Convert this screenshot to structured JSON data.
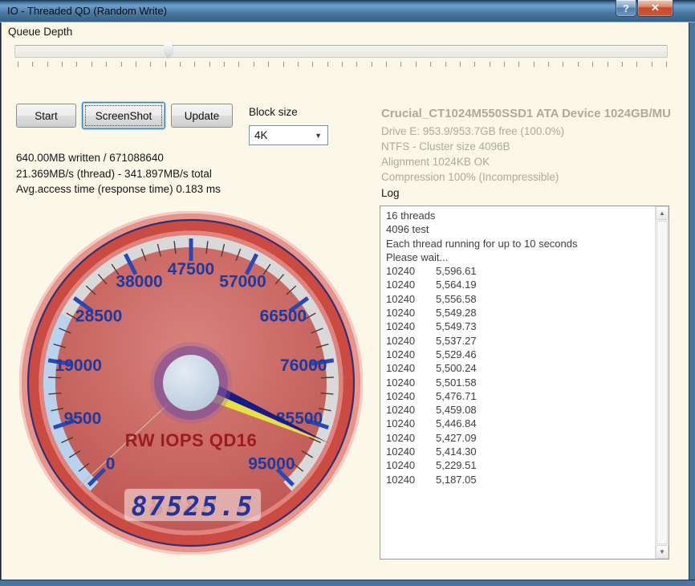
{
  "window": {
    "title": "IO - Threaded QD (Random Write)",
    "help_icon": "?",
    "close_icon": "✕"
  },
  "queue_depth": {
    "label": "Queue Depth",
    "thumb_percent": 23.5,
    "tick_count": 45
  },
  "toolbar": {
    "start": "Start",
    "screenshot": "ScreenShot",
    "update": "Update",
    "block_size_label": "Block size",
    "block_size_value": "4K",
    "combo_arrow": "▼"
  },
  "stats": {
    "lines": [
      "640.00MB written / 671088640",
      "21.369MB/s (thread) - 341.897MB/s total",
      "Avg.access time (response time) 0.183 ms"
    ]
  },
  "device": {
    "title": "Crucial_CT1024M550SSD1 ATA Device 1024GB/MU",
    "lines": [
      "Drive E: 953.9/953.7GB free (100.0%)",
      "NTFS - Cluster size 4096B",
      "Alignment 1024KB OK",
      "Compression 100% (Incompressible)"
    ]
  },
  "log": {
    "label": "Log",
    "scroll_up_icon": "▲",
    "scroll_down_icon": "▼",
    "entries": [
      {
        "text": "16 threads"
      },
      {
        "text": "4096 test"
      },
      {
        "text": "Each thread running for up to 10 seconds"
      },
      {
        "text": "Please wait..."
      },
      {
        "col1": "10240",
        "col2": "5,596.61"
      },
      {
        "col1": "10240",
        "col2": "5,564.19"
      },
      {
        "col1": "10240",
        "col2": "5,556.58"
      },
      {
        "col1": "10240",
        "col2": "5,549.28"
      },
      {
        "col1": "10240",
        "col2": "5,549.73"
      },
      {
        "col1": "10240",
        "col2": "5,537.27"
      },
      {
        "col1": "10240",
        "col2": "5,529.46"
      },
      {
        "col1": "10240",
        "col2": "5,500.24"
      },
      {
        "col1": "10240",
        "col2": "5,501.58"
      },
      {
        "col1": "10240",
        "col2": "5,476.71"
      },
      {
        "col1": "10240",
        "col2": "5,459.08"
      },
      {
        "col1": "10240",
        "col2": "5,446.84"
      },
      {
        "col1": "10240",
        "col2": "5,427.09"
      },
      {
        "col1": "10240",
        "col2": "5,414.30"
      },
      {
        "col1": "10240",
        "col2": "5,229.51"
      },
      {
        "col1": "10240",
        "col2": "5,187.05"
      }
    ]
  },
  "chart_data": {
    "type": "gauge",
    "title": "RW IOPS QD16",
    "min": 0,
    "max": 95000,
    "major_tick_step": 9500,
    "minor_tick_step": 2375,
    "tick_labels": [
      "0",
      "9500",
      "19000",
      "28500",
      "38000",
      "47500",
      "57000",
      "66500",
      "76000",
      "85500",
      "95000"
    ],
    "needle_value": 87525.5,
    "lcd_value": "87525.5",
    "lcd_ghost": "88888.8",
    "start_angle_deg": 135,
    "sweep_deg": 270,
    "band_start_deg": 133,
    "band_end_deg": 407,
    "band_blue_end_deg": 208,
    "marker_line_deg": 137.3
  },
  "colors": {
    "titlebar_blue": "#49779f",
    "close_red": "#c64a2e",
    "client_bg": "#fcf8e9",
    "face_red": "#c5605c",
    "band_gray": "#d9d9d9",
    "band_blue": "#b9d2ee",
    "tick_major_blue": "#2a47b4",
    "tick_minor_dark": "#4a3a38",
    "label_navy": "#1d3aa0",
    "needle_navy": "#141c8c",
    "needle_yellow": "#e6e23f",
    "hub_purple": "#7e4e96",
    "hub_inner": "#c9d7e6",
    "gauge_title_red": "#9a1c22",
    "lcd_navy": "#23339e"
  }
}
